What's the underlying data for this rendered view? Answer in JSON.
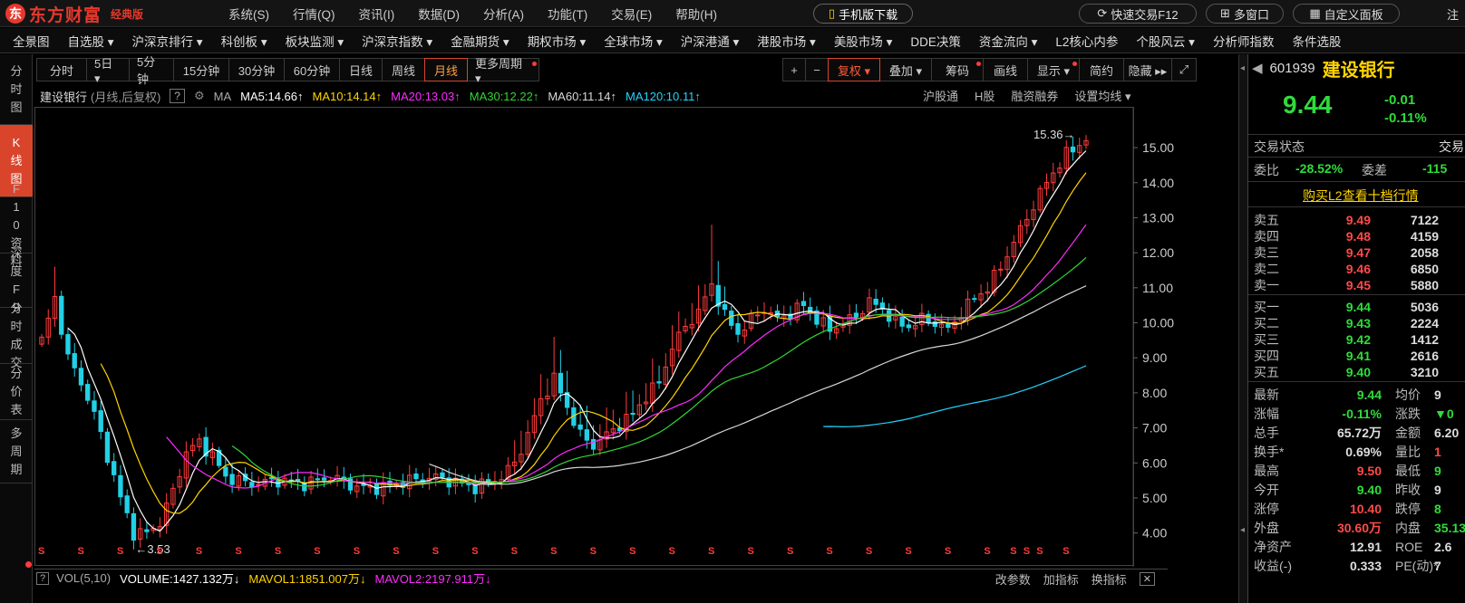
{
  "app": {
    "logo_mark": "东",
    "logo_text": "东方财富",
    "edition": "经典版"
  },
  "menu": [
    "系统(S)",
    "行情(Q)",
    "资讯(I)",
    "数据(D)",
    "分析(A)",
    "功能(T)",
    "交易(E)",
    "帮助(H)"
  ],
  "title_buttons": {
    "mobile": "手机版下载",
    "quick_trade": "快速交易F12",
    "multi_window": "多窗口",
    "custom_panel": "自定义面板",
    "register": "注"
  },
  "nav": [
    "全景图",
    "自选股 ▾",
    "沪深京排行 ▾",
    "科创板 ▾",
    "板块监测 ▾",
    "沪深京指数 ▾",
    "金融期货 ▾",
    "期权市场 ▾",
    "全球市场 ▾",
    "沪深港通 ▾",
    "港股市场 ▾",
    "美股市场 ▾",
    "DDE决策",
    "资金流向 ▾",
    "L2核心内参",
    "个股风云 ▾",
    "分析师指数",
    "条件选股"
  ],
  "left_tabs": [
    {
      "label": "分时图",
      "active": false
    },
    {
      "label": "K线图",
      "active": true
    },
    {
      "label": "F10资料",
      "active": false
    },
    {
      "label": "深度F9",
      "active": false
    },
    {
      "label": "分时成交",
      "active": false
    },
    {
      "label": "分价表",
      "active": false
    },
    {
      "label": "多周期",
      "active": false
    }
  ],
  "periods": [
    {
      "label": "分时"
    },
    {
      "label": "5日 ▾"
    },
    {
      "label": "5分钟"
    },
    {
      "label": "15分钟"
    },
    {
      "label": "30分钟"
    },
    {
      "label": "60分钟"
    },
    {
      "label": "日线"
    },
    {
      "label": "周线"
    },
    {
      "label": "月线",
      "active": true
    },
    {
      "label": "更多周期 ▾",
      "dot": true
    }
  ],
  "tools": [
    {
      "label": "+"
    },
    {
      "label": "−"
    },
    {
      "label": "复权 ▾",
      "active": true
    },
    {
      "label": "叠加 ▾"
    },
    {
      "label": "筹码",
      "dot": true
    },
    {
      "label": "画线"
    },
    {
      "label": "显示 ▾",
      "dot": true
    },
    {
      "label": "简约"
    },
    {
      "label": "隐藏 ▸▸"
    },
    {
      "label": "⤢"
    }
  ],
  "ma_line": {
    "stock": "建设银行",
    "mode": "(月线,后复权)",
    "help": "?",
    "ma_label": "MA",
    "items": [
      {
        "text": "MA5:14.66↑",
        "color": "#ffffff"
      },
      {
        "text": "MA10:14.14↑",
        "color": "#ffd400"
      },
      {
        "text": "MA20:13.03↑",
        "color": "#ff2bff"
      },
      {
        "text": "MA30:12.22↑",
        "color": "#31d631"
      },
      {
        "text": "MA60:11.14↑",
        "color": "#d8d8d8"
      },
      {
        "text": "MA120:10.11↑",
        "color": "#22d4ff"
      }
    ]
  },
  "chart_links": [
    "沪股通",
    "H股",
    "融资融券",
    "设置均线 ▾"
  ],
  "chart_data": {
    "type": "candlestick",
    "period": "monthly",
    "adjust": "后复权",
    "y_ticks": [
      4.0,
      5.0,
      6.0,
      7.0,
      8.0,
      9.0,
      10.0,
      11.0,
      12.0,
      13.0,
      14.0,
      15.0
    ],
    "ylim": [
      3.5,
      15.7
    ],
    "high_label": "15.36",
    "low_label": "3.53",
    "high": 15.36,
    "low": 3.53,
    "up_color": "#ff3b3b",
    "down_color": "#22d0e6",
    "n_bars": 160,
    "anchors": [
      [
        0,
        9.5
      ],
      [
        2,
        10.7
      ],
      [
        4,
        9.0
      ],
      [
        6,
        8.3
      ],
      [
        8,
        7.4
      ],
      [
        10,
        6.2
      ],
      [
        12,
        5.0
      ],
      [
        14,
        4.0
      ],
      [
        16,
        4.0
      ],
      [
        18,
        4.3
      ],
      [
        20,
        5.2
      ],
      [
        22,
        6.3
      ],
      [
        24,
        6.6
      ],
      [
        26,
        6.2
      ],
      [
        28,
        5.6
      ],
      [
        32,
        5.4
      ],
      [
        36,
        5.5
      ],
      [
        40,
        5.4
      ],
      [
        44,
        5.6
      ],
      [
        48,
        5.3
      ],
      [
        52,
        5.3
      ],
      [
        56,
        5.5
      ],
      [
        60,
        5.6
      ],
      [
        64,
        5.4
      ],
      [
        66,
        5.3
      ],
      [
        70,
        5.6
      ],
      [
        72,
        6.0
      ],
      [
        74,
        6.8
      ],
      [
        76,
        7.8
      ],
      [
        78,
        8.4
      ],
      [
        80,
        7.6
      ],
      [
        82,
        6.8
      ],
      [
        84,
        6.5
      ],
      [
        86,
        6.8
      ],
      [
        88,
        7.1
      ],
      [
        90,
        7.4
      ],
      [
        92,
        7.9
      ],
      [
        94,
        8.3
      ],
      [
        96,
        9.3
      ],
      [
        98,
        9.9
      ],
      [
        100,
        10.3
      ],
      [
        102,
        11.1
      ],
      [
        104,
        10.2
      ],
      [
        106,
        9.7
      ],
      [
        108,
        10.1
      ],
      [
        110,
        10.4
      ],
      [
        112,
        10.1
      ],
      [
        114,
        10.3
      ],
      [
        116,
        10.5
      ],
      [
        118,
        10.1
      ],
      [
        120,
        9.8
      ],
      [
        122,
        10.0
      ],
      [
        124,
        10.2
      ],
      [
        126,
        10.6
      ],
      [
        128,
        10.4
      ],
      [
        130,
        10.0
      ],
      [
        132,
        9.9
      ],
      [
        134,
        10.1
      ],
      [
        136,
        10.0
      ],
      [
        138,
        9.8
      ],
      [
        140,
        10.3
      ],
      [
        142,
        10.7
      ],
      [
        144,
        11.0
      ],
      [
        146,
        11.6
      ],
      [
        148,
        12.3
      ],
      [
        150,
        13.0
      ],
      [
        152,
        13.7
      ],
      [
        154,
        14.3
      ],
      [
        156,
        14.8
      ],
      [
        158,
        15.1
      ],
      [
        159,
        15.2
      ]
    ],
    "ma": [
      {
        "name": "MA5",
        "value": 14.66,
        "period": 5,
        "color": "#ffffff"
      },
      {
        "name": "MA10",
        "value": 14.14,
        "period": 10,
        "color": "#ffd400"
      },
      {
        "name": "MA20",
        "value": 13.03,
        "period": 20,
        "color": "#ff2bff"
      },
      {
        "name": "MA30",
        "value": 12.22,
        "period": 30,
        "color": "#31d631"
      },
      {
        "name": "MA60",
        "value": 11.14,
        "period": 60,
        "color": "#d8d8d8"
      },
      {
        "name": "MA120",
        "value": 10.11,
        "period": 120,
        "color": "#22d4ff"
      }
    ],
    "dividend_marker": "S"
  },
  "vol": {
    "name": "VOL(5,10)",
    "volume": "VOLUME:1427.132万↓",
    "mavol1": "MAVOL1:1851.007万↓",
    "mavol2": "MAVOL2:2197.911万↓",
    "links": [
      "改参数",
      "加指标",
      "换指标"
    ],
    "close": "✕"
  },
  "quote": {
    "code": "601939",
    "name": "建设银行",
    "price": "9.44",
    "change": "-0.01",
    "change_pct": "-0.11%",
    "trade_status_label": "交易状态",
    "trade_status_right": "交易",
    "weibi_label": "委比",
    "weibi": "-28.52%",
    "weicha_label": "委差",
    "weicha": "-115",
    "l2_link": "购买L2查看十档行情",
    "asks": [
      {
        "label": "卖五",
        "price": "9.49",
        "vol": "7122"
      },
      {
        "label": "卖四",
        "price": "9.48",
        "vol": "4159"
      },
      {
        "label": "卖三",
        "price": "9.47",
        "vol": "2058"
      },
      {
        "label": "卖二",
        "price": "9.46",
        "vol": "6850"
      },
      {
        "label": "卖一",
        "price": "9.45",
        "vol": "5880"
      }
    ],
    "bids": [
      {
        "label": "买一",
        "price": "9.44",
        "vol": "5036"
      },
      {
        "label": "买二",
        "price": "9.43",
        "vol": "2224"
      },
      {
        "label": "买三",
        "price": "9.42",
        "vol": "1412"
      },
      {
        "label": "买四",
        "price": "9.41",
        "vol": "2616"
      },
      {
        "label": "买五",
        "price": "9.40",
        "vol": "3210"
      }
    ],
    "stats": [
      {
        "l1": "最新",
        "v1": "9.44",
        "c1": "green",
        "l2": "均价",
        "v2": "9",
        "c2": "white"
      },
      {
        "l1": "涨幅",
        "v1": "-0.11%",
        "c1": "green",
        "l2": "涨跌",
        "v2": "▼0",
        "c2": "green"
      },
      {
        "l1": "总手",
        "v1": "65.72万",
        "c1": "white",
        "l2": "金额",
        "v2": "6.20",
        "c2": "white"
      },
      {
        "l1": "换手*",
        "v1": "0.69%",
        "c1": "white",
        "l2": "量比",
        "v2": "1",
        "c2": "red"
      },
      {
        "l1": "最高",
        "v1": "9.50",
        "c1": "red",
        "l2": "最低",
        "v2": "9",
        "c2": "green"
      },
      {
        "l1": "今开",
        "v1": "9.40",
        "c1": "green",
        "l2": "昨收",
        "v2": "9",
        "c2": "white"
      },
      {
        "l1": "涨停",
        "v1": "10.40",
        "c1": "red",
        "l2": "跌停",
        "v2": "8",
        "c2": "green"
      },
      {
        "l1": "外盘",
        "v1": "30.60万",
        "c1": "red",
        "l2": "内盘",
        "v2": "35.13",
        "c2": "green"
      },
      {
        "l1": "净资产",
        "v1": "12.91",
        "c1": "white",
        "l2": "ROE",
        "v2": "2.6",
        "c2": "white"
      },
      {
        "l1": "收益(-)",
        "v1": "0.333",
        "c1": "white",
        "l2": "PE(动)*",
        "v2": "7",
        "c2": "white"
      }
    ]
  }
}
